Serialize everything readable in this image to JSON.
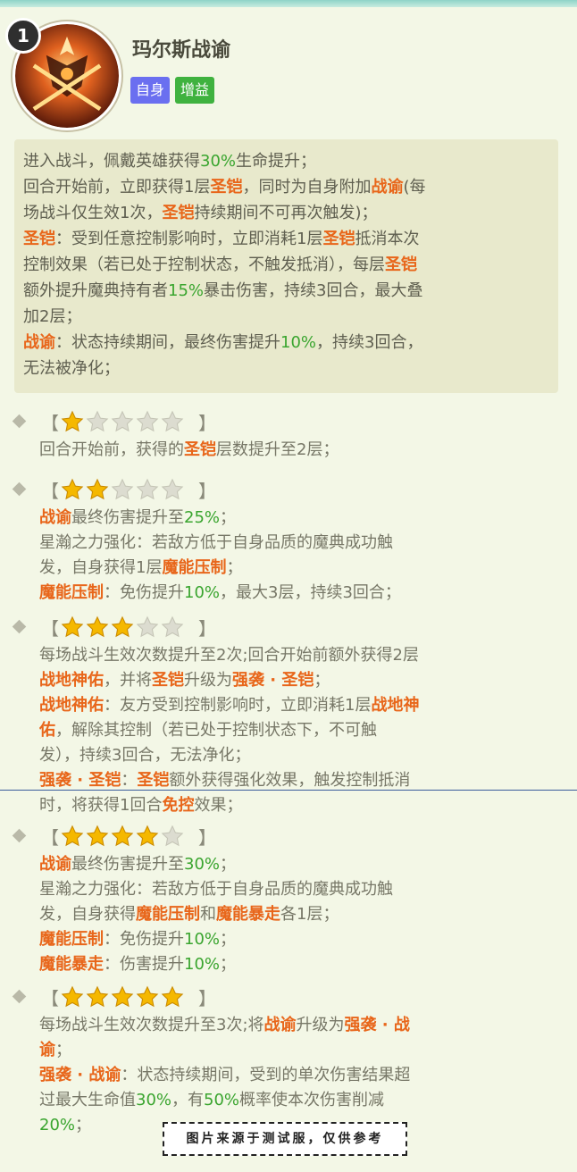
{
  "skill": {
    "level_badge": "1",
    "name": "玛尔斯战谕",
    "tags": [
      "自身",
      "增益"
    ]
  },
  "description": [
    [
      {
        "t": "进入战斗，佩戴英雄获得"
      },
      {
        "t": "30%",
        "c": "g"
      },
      {
        "t": "生命提升；"
      }
    ],
    [
      {
        "t": "回合开始前，立即获得1层"
      },
      {
        "t": "圣铠",
        "c": "o"
      },
      {
        "t": "，同时为自身附加"
      },
      {
        "t": "战谕",
        "c": "o"
      },
      {
        "t": "(每"
      }
    ],
    [
      {
        "t": "场战斗仅生效1次，"
      },
      {
        "t": "圣铠",
        "c": "o"
      },
      {
        "t": "持续期间不可再次触发)；"
      }
    ],
    [
      {
        "t": "圣铠",
        "c": "o"
      },
      {
        "t": "：受到任意控制影响时，立即消耗1层"
      },
      {
        "t": "圣铠",
        "c": "o"
      },
      {
        "t": "抵消本次"
      }
    ],
    [
      {
        "t": "控制效果（若已处于控制状态，不触发抵消），每层"
      },
      {
        "t": "圣铠",
        "c": "o"
      }
    ],
    [
      {
        "t": "额外提升魔典持有者"
      },
      {
        "t": "15%",
        "c": "g"
      },
      {
        "t": "暴击伤害，持续3回合，最大叠"
      }
    ],
    [
      {
        "t": "加2层；"
      }
    ],
    [
      {
        "t": "战谕",
        "c": "o"
      },
      {
        "t": "：状态持续期间，最终伤害提升"
      },
      {
        "t": "10%",
        "c": "g"
      },
      {
        "t": "，持续3回合，"
      }
    ],
    [
      {
        "t": "无法被净化；"
      }
    ]
  ],
  "bracket_open": "【",
  "bracket_close": "】",
  "star_tiers": [
    {
      "stars": 1,
      "lines": [
        [
          {
            "t": "回合开始前，获得的"
          },
          {
            "t": "圣铠",
            "c": "o"
          },
          {
            "t": "层数提升至2层；"
          }
        ]
      ]
    },
    {
      "stars": 2,
      "lines": [
        [
          {
            "t": "战谕",
            "c": "o"
          },
          {
            "t": "最终伤害提升至"
          },
          {
            "t": "25%",
            "c": "g"
          },
          {
            "t": "；"
          }
        ],
        [
          {
            "t": "星瀚之力强化：若敌方低于自身品质的魔典成功触"
          }
        ],
        [
          {
            "t": "发，自身获得1层"
          },
          {
            "t": "魔能压制",
            "c": "o"
          },
          {
            "t": "；"
          }
        ],
        [
          {
            "t": "魔能压制",
            "c": "o"
          },
          {
            "t": "：免伤提升"
          },
          {
            "t": "10%",
            "c": "g"
          },
          {
            "t": "，最大3层，持续3回合；"
          }
        ]
      ]
    },
    {
      "stars": 3,
      "lines": [
        [
          {
            "t": "每场战斗生效次数提升至2次;回合开始前额外获得2层"
          }
        ],
        [
          {
            "t": "战地神佑",
            "c": "o"
          },
          {
            "t": "，并将"
          },
          {
            "t": "圣铠",
            "c": "o"
          },
          {
            "t": "升级为"
          },
          {
            "t": "强袭 · 圣铠",
            "c": "o"
          },
          {
            "t": "；"
          }
        ],
        [
          {
            "t": "战地神佑",
            "c": "o"
          },
          {
            "t": "：友方受到控制影响时，立即消耗1层"
          },
          {
            "t": "战地神",
            "c": "o"
          }
        ],
        [
          {
            "t": "佑",
            "c": "o"
          },
          {
            "t": "，解除其控制（若已处于控制状态下，不可触"
          }
        ],
        [
          {
            "t": "发），持续3回合，无法净化；"
          }
        ],
        [
          {
            "t": "强袭 · 圣铠",
            "c": "o"
          },
          {
            "t": "："
          },
          {
            "t": "圣铠",
            "c": "o"
          },
          {
            "t": "额外获得强化效果，触发控制抵消"
          }
        ],
        [
          {
            "t": "时，将获得1回合"
          },
          {
            "t": "免控",
            "c": "o"
          },
          {
            "t": "效果；"
          }
        ]
      ]
    },
    {
      "stars": 4,
      "lines": [
        [
          {
            "t": "战谕",
            "c": "o"
          },
          {
            "t": "最终伤害提升至"
          },
          {
            "t": "30%",
            "c": "g"
          },
          {
            "t": "；"
          }
        ],
        [
          {
            "t": "星瀚之力强化：若敌方低于自身品质的魔典成功触"
          }
        ],
        [
          {
            "t": "发，自身获得"
          },
          {
            "t": "魔能压制",
            "c": "o"
          },
          {
            "t": "和"
          },
          {
            "t": "魔能暴走",
            "c": "o"
          },
          {
            "t": "各1层；"
          }
        ],
        [
          {
            "t": "魔能压制",
            "c": "o"
          },
          {
            "t": "：免伤提升"
          },
          {
            "t": "10%",
            "c": "g"
          },
          {
            "t": "；"
          }
        ],
        [
          {
            "t": "魔能暴走",
            "c": "o"
          },
          {
            "t": "：伤害提升"
          },
          {
            "t": "10%",
            "c": "g"
          },
          {
            "t": "；"
          }
        ]
      ]
    },
    {
      "stars": 5,
      "lines": [
        [
          {
            "t": "每场战斗生效次数提升至3次;将"
          },
          {
            "t": "战谕",
            "c": "o"
          },
          {
            "t": "升级为"
          },
          {
            "t": "强袭 · 战",
            "c": "o"
          }
        ],
        [
          {
            "t": "谕",
            "c": "o"
          },
          {
            "t": "；"
          }
        ],
        [
          {
            "t": "强袭 · 战谕",
            "c": "o"
          },
          {
            "t": "：状态持续期间，受到的单次伤害结果超"
          }
        ],
        [
          {
            "t": "过最大生命值"
          },
          {
            "t": "30%",
            "c": "g"
          },
          {
            "t": "，有"
          },
          {
            "t": "50%",
            "c": "g"
          },
          {
            "t": "概率使本次伤害削减"
          }
        ],
        [
          {
            "t": "20%",
            "c": "g"
          },
          {
            "t": "；"
          }
        ]
      ]
    }
  ],
  "watermark": "图片来源于测试服，仅供参考",
  "colors": {
    "highlight_orange": "#e8661a",
    "highlight_green": "#3aa52f",
    "star_gold": "#f5b800",
    "star_empty": "#d8d8cc"
  }
}
